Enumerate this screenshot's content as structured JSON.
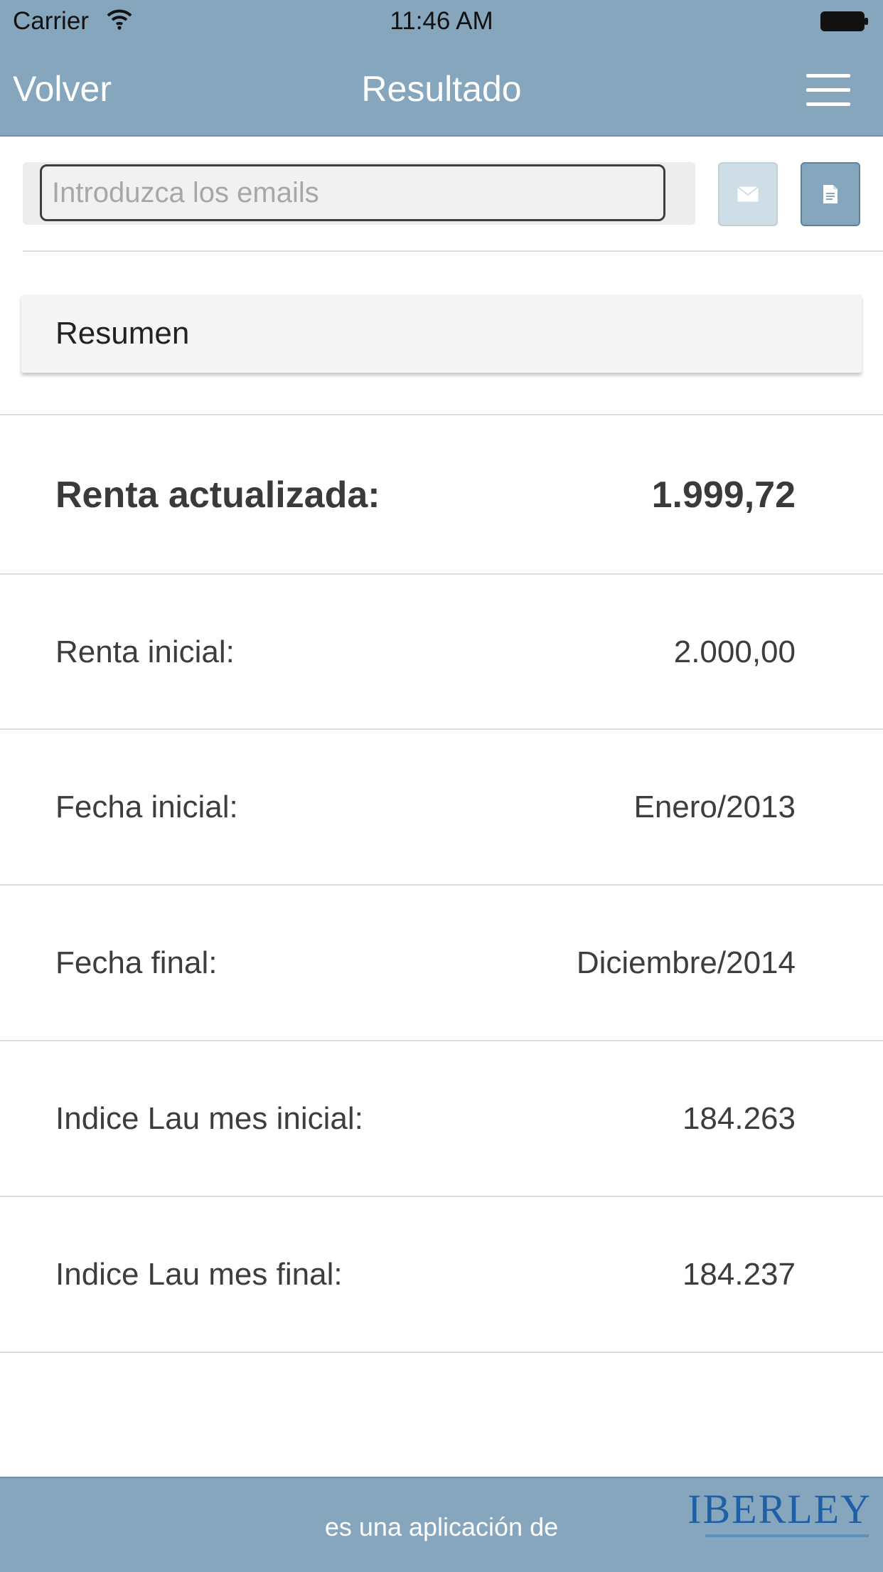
{
  "status_bar": {
    "carrier": "Carrier",
    "time": "11:46 AM"
  },
  "nav": {
    "back_label": "Volver",
    "title": "Resultado"
  },
  "email": {
    "placeholder": "Introduzca los emails",
    "value": ""
  },
  "summary": {
    "header": "Resumen",
    "rows": [
      {
        "label": "Renta actualizada:",
        "value": "1.999,72"
      },
      {
        "label": "Renta inicial:",
        "value": "2.000,00"
      },
      {
        "label": "Fecha inicial:",
        "value": "Enero/2013"
      },
      {
        "label": "Fecha final:",
        "value": "Diciembre/2014"
      },
      {
        "label": "Indice Lau mes inicial:",
        "value": "184.263"
      },
      {
        "label": "Indice Lau mes final:",
        "value": "184.237"
      }
    ]
  },
  "footer": {
    "text": "es una aplicación de",
    "logo_text": "IBERLEY"
  },
  "colors": {
    "bar": "#85a6bd",
    "logo": "#1f5fa6"
  },
  "icons": {
    "wifi": "wifi-icon",
    "battery": "battery-icon",
    "menu": "hamburger-menu-icon",
    "mail": "envelope-icon",
    "document": "document-icon"
  }
}
